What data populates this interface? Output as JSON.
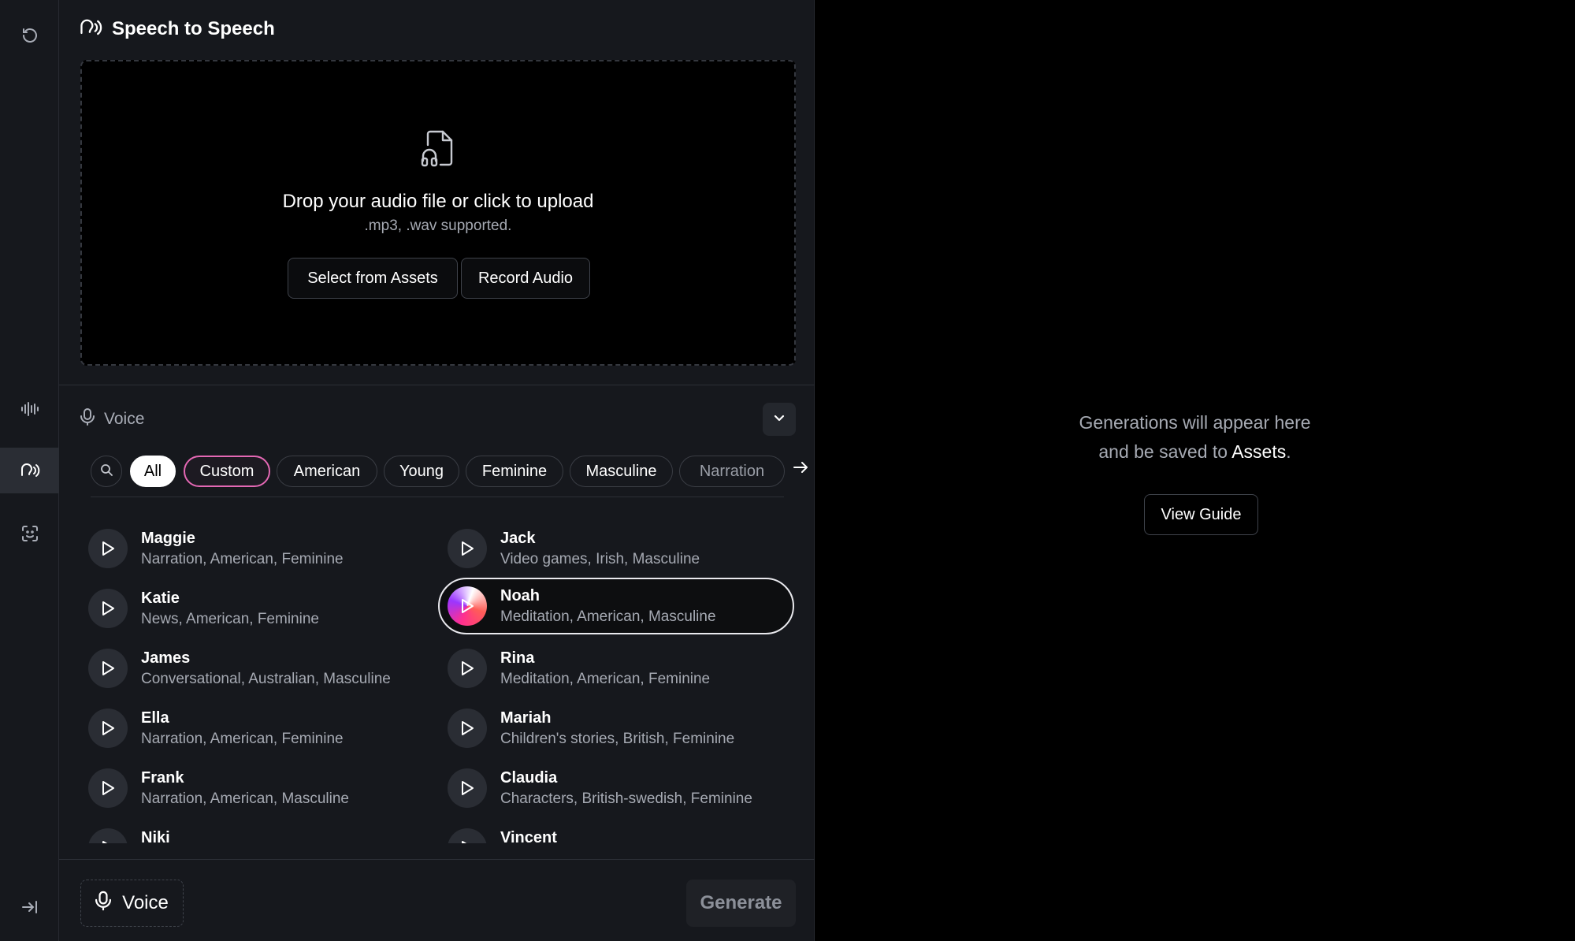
{
  "header": {
    "title": "Speech to Speech"
  },
  "upload": {
    "title": "Drop your audio file or click to upload",
    "subtitle": ".mp3, .wav supported.",
    "select_assets": "Select from Assets",
    "record_audio": "Record Audio"
  },
  "voice_section": {
    "label": "Voice"
  },
  "filters": {
    "search_icon": "search-icon",
    "chips": [
      "All",
      "Custom",
      "American",
      "Young",
      "Feminine",
      "Masculine",
      "Narration"
    ],
    "selected": "All"
  },
  "voices": [
    {
      "name": "Maggie",
      "tags": "Narration, American, Feminine"
    },
    {
      "name": "Jack",
      "tags": "Video games, Irish, Masculine"
    },
    {
      "name": "Katie",
      "tags": "News, American, Feminine"
    },
    {
      "name": "Noah",
      "tags": "Meditation, American, Masculine",
      "selected": true
    },
    {
      "name": "James",
      "tags": "Conversational, Australian, Masculine"
    },
    {
      "name": "Rina",
      "tags": "Meditation, American, Feminine"
    },
    {
      "name": "Ella",
      "tags": "Narration, American, Feminine"
    },
    {
      "name": "Mariah",
      "tags": "Children's stories, British, Feminine"
    },
    {
      "name": "Frank",
      "tags": "Narration, American, Masculine"
    },
    {
      "name": "Claudia",
      "tags": "Characters, British-swedish, Feminine"
    },
    {
      "name": "Niki",
      "tags": ""
    },
    {
      "name": "Vincent",
      "tags": ""
    }
  ],
  "footer": {
    "voice_label": "Voice",
    "generate_label": "Generate"
  },
  "empty_state": {
    "line1": "Generations will appear here",
    "line2_prefix": "and be saved to",
    "line2_link": "Assets",
    "line2_suffix": ".",
    "guide_button": "View Guide"
  },
  "colors": {
    "accent_pink": "#e468b4",
    "panel_bg": "#16181d",
    "canvas_bg": "#000000"
  }
}
